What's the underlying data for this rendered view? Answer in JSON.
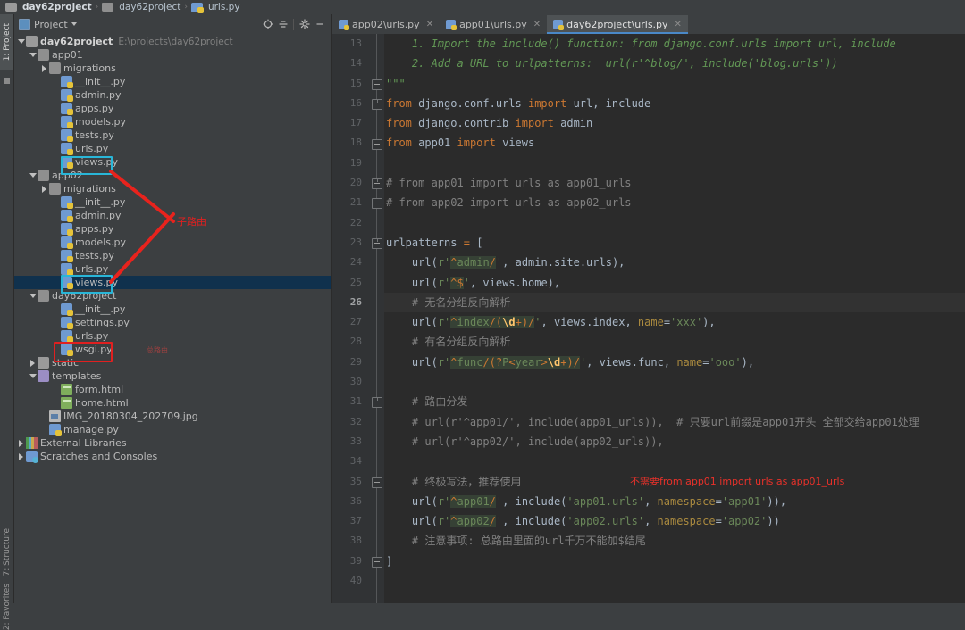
{
  "breadcrumb": {
    "items": [
      {
        "label": "day62project",
        "icon": "folder-icon",
        "bold": true
      },
      {
        "label": "day62project",
        "icon": "folder-module-icon",
        "bold": false
      },
      {
        "label": "urls.py",
        "icon": "python-file-icon",
        "bold": false
      }
    ],
    "separator": "›"
  },
  "rail": {
    "top_tab": "1: Project",
    "bottom_tabs": [
      "7: Structure",
      "2: Favorites"
    ]
  },
  "project_panel": {
    "title": "Project",
    "toolbar": [
      {
        "name": "locate-icon",
        "glyph": "⊕"
      },
      {
        "name": "collapse-all-icon",
        "glyph": "≡"
      },
      {
        "name": "settings-gear-icon",
        "glyph": "⚙"
      },
      {
        "name": "hide-panel-icon",
        "glyph": "—"
      }
    ],
    "tree": [
      {
        "depth": 0,
        "arrow": "down",
        "icon": "folder-icon",
        "label": "day62project",
        "bold": true,
        "path": "E:\\projects\\day62project"
      },
      {
        "depth": 1,
        "arrow": "down",
        "icon": "folder-module-icon",
        "label": "app01"
      },
      {
        "depth": 2,
        "arrow": "right",
        "icon": "folder-module-icon",
        "label": "migrations"
      },
      {
        "depth": 3,
        "arrow": "none",
        "icon": "python-file-icon",
        "label": "__init__.py"
      },
      {
        "depth": 3,
        "arrow": "none",
        "icon": "python-file-icon",
        "label": "admin.py"
      },
      {
        "depth": 3,
        "arrow": "none",
        "icon": "python-file-icon",
        "label": "apps.py"
      },
      {
        "depth": 3,
        "arrow": "none",
        "icon": "python-file-icon",
        "label": "models.py"
      },
      {
        "depth": 3,
        "arrow": "none",
        "icon": "python-file-icon",
        "label": "tests.py"
      },
      {
        "depth": 3,
        "arrow": "none",
        "icon": "python-file-icon",
        "label": "urls.py"
      },
      {
        "depth": 3,
        "arrow": "none",
        "icon": "python-file-icon",
        "label": "views.py"
      },
      {
        "depth": 1,
        "arrow": "down",
        "icon": "folder-module-icon",
        "label": "app02"
      },
      {
        "depth": 2,
        "arrow": "right",
        "icon": "folder-module-icon",
        "label": "migrations"
      },
      {
        "depth": 3,
        "arrow": "none",
        "icon": "python-file-icon",
        "label": "__init__.py"
      },
      {
        "depth": 3,
        "arrow": "none",
        "icon": "python-file-icon",
        "label": "admin.py"
      },
      {
        "depth": 3,
        "arrow": "none",
        "icon": "python-file-icon",
        "label": "apps.py"
      },
      {
        "depth": 3,
        "arrow": "none",
        "icon": "python-file-icon",
        "label": "models.py"
      },
      {
        "depth": 3,
        "arrow": "none",
        "icon": "python-file-icon",
        "label": "tests.py"
      },
      {
        "depth": 3,
        "arrow": "none",
        "icon": "python-file-icon",
        "label": "urls.py"
      },
      {
        "depth": 3,
        "arrow": "none",
        "icon": "python-file-icon",
        "label": "views.py",
        "selected": true
      },
      {
        "depth": 1,
        "arrow": "down",
        "icon": "folder-module-icon",
        "label": "day62project"
      },
      {
        "depth": 3,
        "arrow": "none",
        "icon": "python-file-icon",
        "label": "__init__.py"
      },
      {
        "depth": 3,
        "arrow": "none",
        "icon": "python-file-icon",
        "label": "settings.py"
      },
      {
        "depth": 3,
        "arrow": "none",
        "icon": "python-file-icon",
        "label": "urls.py"
      },
      {
        "depth": 3,
        "arrow": "none",
        "icon": "python-file-icon",
        "label": "wsgi.py"
      },
      {
        "depth": 1,
        "arrow": "right",
        "icon": "folder-icon",
        "label": "static"
      },
      {
        "depth": 1,
        "arrow": "down",
        "icon": "folder-templates-icon",
        "label": "templates"
      },
      {
        "depth": 3,
        "arrow": "none",
        "icon": "html-file-icon",
        "label": "form.html"
      },
      {
        "depth": 3,
        "arrow": "none",
        "icon": "html-file-icon",
        "label": "home.html"
      },
      {
        "depth": 2,
        "arrow": "none",
        "icon": "image-file-icon",
        "label": "IMG_20180304_202709.jpg"
      },
      {
        "depth": 2,
        "arrow": "none",
        "icon": "python-file-icon",
        "label": "manage.py"
      },
      {
        "depth": 0,
        "arrow": "right",
        "icon": "library-icon",
        "label": "External Libraries"
      },
      {
        "depth": 0,
        "arrow": "right",
        "icon": "scratches-icon",
        "label": "Scratches and Consoles"
      }
    ],
    "annotations": {
      "sub_route_label": "子路由",
      "main_route_label": "总路由"
    }
  },
  "editor": {
    "tabs": [
      {
        "label": "app02\\urls.py",
        "active": false,
        "close": "✕"
      },
      {
        "label": "app01\\urls.py",
        "active": false,
        "close": "✕"
      },
      {
        "label": "day62project\\urls.py",
        "active": true,
        "close": "✕"
      }
    ],
    "current_line": 26,
    "annotation": "不需要from app01 import urls as app01_urls",
    "lines": [
      {
        "n": 13,
        "fold": "none"
      },
      {
        "n": 14,
        "fold": "none"
      },
      {
        "n": 15,
        "fold": "end"
      },
      {
        "n": 16,
        "fold": "open"
      },
      {
        "n": 17,
        "fold": "none"
      },
      {
        "n": 18,
        "fold": "end"
      },
      {
        "n": 19,
        "fold": "none"
      },
      {
        "n": 20,
        "fold": "open"
      },
      {
        "n": 21,
        "fold": "end"
      },
      {
        "n": 22,
        "fold": "none"
      },
      {
        "n": 23,
        "fold": "open"
      },
      {
        "n": 24,
        "fold": "none"
      },
      {
        "n": 25,
        "fold": "none"
      },
      {
        "n": 26,
        "fold": "none"
      },
      {
        "n": 27,
        "fold": "none"
      },
      {
        "n": 28,
        "fold": "none"
      },
      {
        "n": 29,
        "fold": "none"
      },
      {
        "n": 30,
        "fold": "none"
      },
      {
        "n": 31,
        "fold": "open"
      },
      {
        "n": 32,
        "fold": "none"
      },
      {
        "n": 33,
        "fold": "none"
      },
      {
        "n": 34,
        "fold": "none"
      },
      {
        "n": 35,
        "fold": "end"
      },
      {
        "n": 36,
        "fold": "none"
      },
      {
        "n": 37,
        "fold": "none"
      },
      {
        "n": 38,
        "fold": "none"
      },
      {
        "n": 39,
        "fold": "end"
      },
      {
        "n": 40,
        "fold": "none"
      }
    ],
    "source_text": [
      "    1. Import the include() function: from django.conf.urls import url, include",
      "    2. Add a URL to urlpatterns:  url(r'^blog/', include('blog.urls'))",
      "\"\"\"",
      "from django.conf.urls import url, include",
      "from django.contrib import admin",
      "from app01 import views",
      "",
      "# from app01 import urls as app01_urls",
      "# from app02 import urls as app02_urls",
      "",
      "urlpatterns = [",
      "    url(r'^admin/', admin.site.urls),",
      "    url(r'^$', views.home),",
      "    # 无名分组反向解析",
      "    url(r'^index/(\\d+)/', views.index, name='xxx'),",
      "    # 有名分组反向解析",
      "    url(r'^func/(?P<year>\\d+)/', views.func, name='ooo'),",
      "",
      "    # 路由分发",
      "    # url(r'^app01/', include(app01_urls)),  # 只要url前缀是app01开头 全部交给app01处理",
      "    # url(r'^app02/', include(app02_urls)),",
      "",
      "    # 终极写法，推荐使用",
      "    url(r'^app01/', include('app01.urls', namespace='app01')),",
      "    url(r'^app02/', include('app02.urls', namespace='app02'))",
      "    # 注意事项: 总路由里面的url千万不能加$结尾",
      "]",
      ""
    ]
  },
  "colors": {
    "panel_bg": "#3c3f41",
    "editor_bg": "#2b2b2b",
    "gutter_bg": "#313335",
    "selection": "#10314d",
    "accent_tab": "#4a88c7",
    "annotation_red": "#e8312a",
    "box_cyan": "#29b6d8",
    "box_red": "#e02020",
    "keyword": "#cc7832",
    "string": "#6a8759",
    "comment": "#808080",
    "docstring": "#629755",
    "regex_bg": "#364135",
    "regex_class": "#ffc66d",
    "param": "#aa8a3f"
  }
}
